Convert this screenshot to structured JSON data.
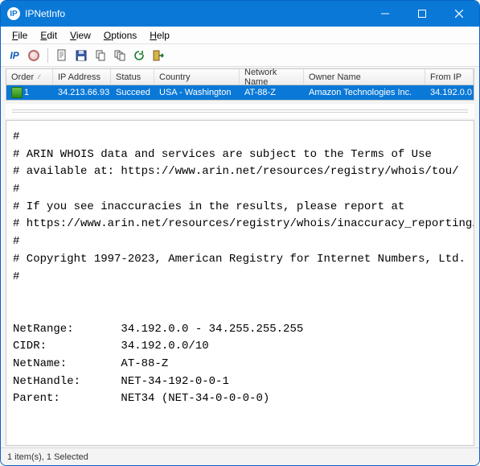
{
  "window": {
    "title": "IPNetInfo"
  },
  "menu": {
    "file": {
      "label": "File",
      "hotkey_index": 0
    },
    "edit": {
      "label": "Edit",
      "hotkey_index": 0
    },
    "view": {
      "label": "View",
      "hotkey_index": 0
    },
    "options": {
      "label": "Options",
      "hotkey_index": 0
    },
    "help": {
      "label": "Help",
      "hotkey_index": 0
    }
  },
  "toolbar": {
    "ip_label": "IP"
  },
  "table": {
    "headers": {
      "order": "Order",
      "ip": "IP Address",
      "status": "Status",
      "country": "Country",
      "network": "Network Name",
      "owner": "Owner Name",
      "from": "From IP"
    },
    "rows": [
      {
        "order": "1",
        "ip": "34.213.66.93",
        "status": "Succeed",
        "country": "USA - Washington",
        "network": "AT-88-Z",
        "owner": "Amazon Technologies Inc.",
        "from": "34.192.0.0"
      }
    ]
  },
  "details_text": "#\n# ARIN WHOIS data and services are subject to the Terms of Use\n# available at: https://www.arin.net/resources/registry/whois/tou/\n#\n# If you see inaccuracies in the results, please report at\n# https://www.arin.net/resources/registry/whois/inaccuracy_reporting/\n#\n# Copyright 1997-2023, American Registry for Internet Numbers, Ltd.\n#\n\n\nNetRange:       34.192.0.0 - 34.255.255.255\nCIDR:           34.192.0.0/10\nNetName:        AT-88-Z\nNetHandle:      NET-34-192-0-0-1\nParent:         NET34 (NET-34-0-0-0-0)\n",
  "status": {
    "text": "1 item(s), 1 Selected"
  }
}
